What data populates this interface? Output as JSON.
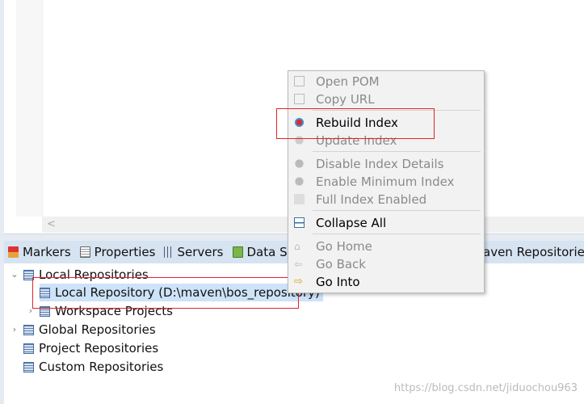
{
  "editor": {
    "scroll_left_glyph": "<"
  },
  "tabs": [
    {
      "label": "Markers",
      "icon": "markers-icon"
    },
    {
      "label": "Properties",
      "icon": "properties-icon"
    },
    {
      "label": "Servers",
      "icon": "servers-icon"
    },
    {
      "label": "Data So",
      "icon": "data-source-icon"
    },
    {
      "label": "aven Repositories",
      "icon": ""
    }
  ],
  "tree": {
    "local": "Local Repositories",
    "local_repo": "Local Repository (D:\\maven\\bos_repository)",
    "workspace": "Workspace Projects",
    "global": "Global Repositories",
    "project": "Project Repositories",
    "custom": "Custom Repositories"
  },
  "menu": {
    "open_pom": "Open POM",
    "copy_url": "Copy URL",
    "rebuild": "Rebuild Index",
    "update": "Update Index",
    "disable": "Disable Index Details",
    "minimum": "Enable Minimum Index",
    "full": "Full Index Enabled",
    "collapse": "Collapse All",
    "home": "Go Home",
    "back": "Go Back",
    "into": "Go Into"
  },
  "watermark": "https://blog.csdn.net/jiduochou963",
  "colors": {
    "highlight": "#e2242a",
    "selection": "#cde3f8",
    "tab_bar": "#d6e3f1"
  }
}
